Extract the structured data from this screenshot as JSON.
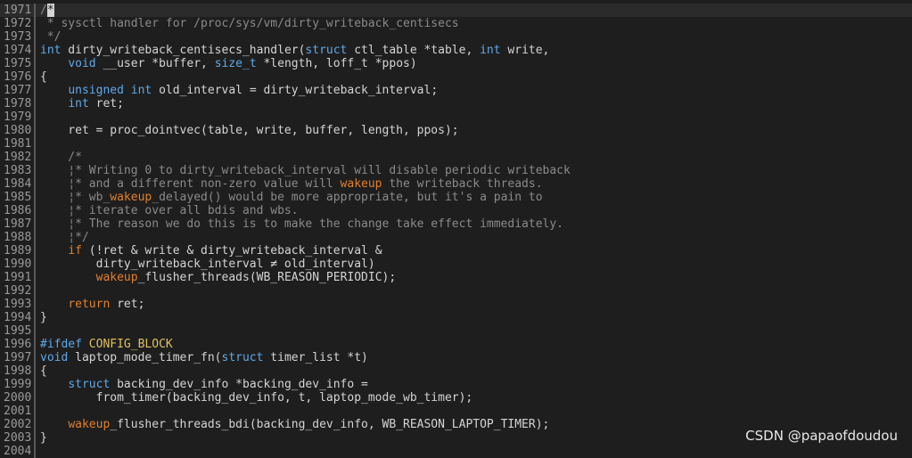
{
  "lines": [
    {
      "n": "1971",
      "current": true,
      "t": [
        [
          "/",
          "comment"
        ],
        [
          "*",
          "cursor"
        ]
      ]
    },
    {
      "n": "1972",
      "t": [
        [
          " * sysctl handler for /proc/sys/vm/dirty_writeback_centisecs",
          "comment"
        ]
      ]
    },
    {
      "n": "1973",
      "t": [
        [
          " */",
          "comment"
        ]
      ]
    },
    {
      "n": "1974",
      "t": [
        [
          "int",
          "type"
        ],
        [
          " dirty_writeback_centisecs_handler(",
          ""
        ],
        [
          "struct",
          "type"
        ],
        [
          " ctl_table *table, ",
          ""
        ],
        [
          "int",
          "type"
        ],
        [
          " write,",
          ""
        ]
      ]
    },
    {
      "n": "1975",
      "t": [
        [
          "    ",
          ""
        ],
        [
          "void",
          "type"
        ],
        [
          " __user *buffer, ",
          ""
        ],
        [
          "size_t",
          "type"
        ],
        [
          " *length, loff_t *ppos)",
          ""
        ]
      ]
    },
    {
      "n": "1976",
      "t": [
        [
          "{",
          ""
        ]
      ]
    },
    {
      "n": "1977",
      "t": [
        [
          "    ",
          ""
        ],
        [
          "unsigned",
          "type"
        ],
        [
          " ",
          ""
        ],
        [
          "int",
          "type"
        ],
        [
          " old_interval = dirty_writeback_interval;",
          ""
        ]
      ]
    },
    {
      "n": "1978",
      "t": [
        [
          "    ",
          ""
        ],
        [
          "int",
          "type"
        ],
        [
          " ret;",
          ""
        ]
      ]
    },
    {
      "n": "1979",
      "t": [
        [
          "",
          ""
        ]
      ]
    },
    {
      "n": "1980",
      "t": [
        [
          "    ret = proc_dointvec(table, write, buffer, length, ppos);",
          ""
        ]
      ]
    },
    {
      "n": "1981",
      "t": [
        [
          "",
          ""
        ]
      ]
    },
    {
      "n": "1982",
      "t": [
        [
          "    /*",
          "comment"
        ]
      ]
    },
    {
      "n": "1983",
      "t": [
        [
          "    ¦* Writing 0 to dirty_writeback_interval will disable periodic writeback",
          "comment"
        ]
      ]
    },
    {
      "n": "1984",
      "t": [
        [
          "    ¦* and a different non-zero value will ",
          "comment"
        ],
        [
          "wakeup",
          "warn"
        ],
        [
          " the writeback threads.",
          "comment"
        ]
      ]
    },
    {
      "n": "1985",
      "t": [
        [
          "    ¦* wb_",
          "comment"
        ],
        [
          "wakeup",
          "warn"
        ],
        [
          "_delayed() would be more appropriate, but it's a pain to",
          "comment"
        ]
      ]
    },
    {
      "n": "1986",
      "t": [
        [
          "    ¦* iterate over all bdis and wbs.",
          "comment"
        ]
      ]
    },
    {
      "n": "1987",
      "t": [
        [
          "    ¦* The reason we do this is to make the change take effect immediately.",
          "comment"
        ]
      ]
    },
    {
      "n": "1988",
      "t": [
        [
          "    ¦*/",
          "comment"
        ]
      ]
    },
    {
      "n": "1989",
      "t": [
        [
          "    ",
          ""
        ],
        [
          "if",
          "warn"
        ],
        [
          " (!ret & write & dirty_writeback_interval &",
          ""
        ]
      ]
    },
    {
      "n": "1990",
      "t": [
        [
          "        dirty_writeback_interval ≠ old_interval)",
          ""
        ]
      ]
    },
    {
      "n": "1991",
      "t": [
        [
          "        ",
          ""
        ],
        [
          "wakeup",
          "warn"
        ],
        [
          "_flusher_threads(WB_REASON_PERIODIC);",
          ""
        ]
      ]
    },
    {
      "n": "1992",
      "t": [
        [
          "",
          ""
        ]
      ]
    },
    {
      "n": "1993",
      "t": [
        [
          "    ",
          ""
        ],
        [
          "return",
          "warn"
        ],
        [
          " ret;",
          ""
        ]
      ]
    },
    {
      "n": "1994",
      "t": [
        [
          "}",
          ""
        ]
      ]
    },
    {
      "n": "1995",
      "t": [
        [
          "",
          ""
        ]
      ]
    },
    {
      "n": "1996",
      "t": [
        [
          "#ifdef",
          "pre"
        ],
        [
          " ",
          ""
        ],
        [
          "CONFIG_BLOCK",
          "macro"
        ]
      ]
    },
    {
      "n": "1997",
      "t": [
        [
          "void",
          "type"
        ],
        [
          " laptop_mode_timer_fn(",
          ""
        ],
        [
          "struct",
          "type"
        ],
        [
          " timer_list *t)",
          ""
        ]
      ]
    },
    {
      "n": "1998",
      "t": [
        [
          "{",
          ""
        ]
      ]
    },
    {
      "n": "1999",
      "t": [
        [
          "    ",
          ""
        ],
        [
          "struct",
          "type"
        ],
        [
          " backing_dev_info *backing_dev_info =",
          ""
        ]
      ]
    },
    {
      "n": "2000",
      "t": [
        [
          "        from_timer(backing_dev_info, t, laptop_mode_wb_timer);",
          ""
        ]
      ]
    },
    {
      "n": "2001",
      "t": [
        [
          "",
          ""
        ]
      ]
    },
    {
      "n": "2002",
      "t": [
        [
          "    ",
          ""
        ],
        [
          "wakeup",
          "warn"
        ],
        [
          "_flusher_threads_bdi(backing_dev_info, WB_REASON_LAPTOP_TIMER);",
          ""
        ]
      ]
    },
    {
      "n": "2003",
      "t": [
        [
          "}",
          ""
        ]
      ]
    },
    {
      "n": "2004",
      "t": [
        [
          "",
          ""
        ]
      ]
    }
  ],
  "watermark": "CSDN @papaofdoudou"
}
